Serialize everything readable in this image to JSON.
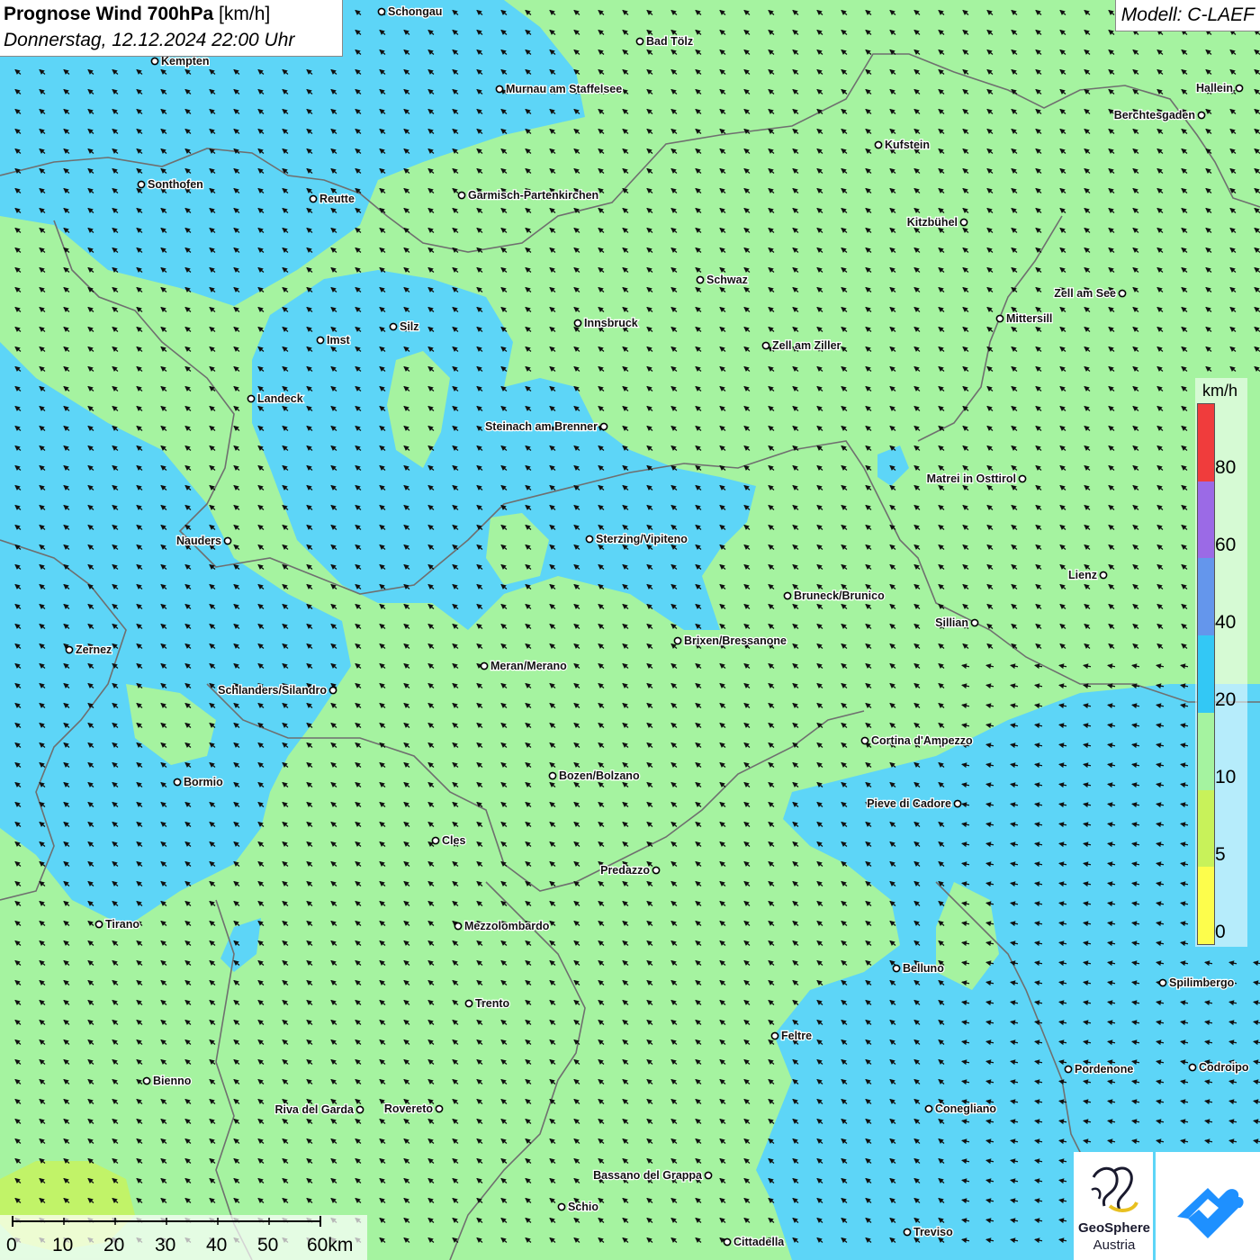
{
  "title": {
    "main": "Prognose Wind 700hPa",
    "unit": "[km/h]",
    "datetime": "Donnerstag, 12.12.2024 22:00 Uhr"
  },
  "model_label": "Modell: C-LAEF",
  "legend": {
    "unit": "km/h",
    "labels": [
      "80",
      "60",
      "40",
      "20",
      "10",
      "5",
      "0"
    ],
    "bins": [
      {
        "from": 0,
        "to": 5,
        "color": "#fdfd4c"
      },
      {
        "from": 5,
        "to": 10,
        "color": "#c8f25a"
      },
      {
        "from": 10,
        "to": 20,
        "color": "#a5f3a0"
      },
      {
        "from": 20,
        "to": 40,
        "color": "#33c8f5"
      },
      {
        "from": 40,
        "to": 60,
        "color": "#6496ec"
      },
      {
        "from": 60,
        "to": 80,
        "color": "#9b6ae6"
      },
      {
        "from": 80,
        "to": 100,
        "color": "#f03c3c"
      }
    ]
  },
  "scale_bar": {
    "labels": [
      "0",
      "10",
      "20",
      "30",
      "40",
      "50",
      "60km"
    ]
  },
  "logos": {
    "geosphere_line1": "GeoSphere",
    "geosphere_line2": "Austria"
  },
  "colors": {
    "green_10_20": "#a5f3a0",
    "blue_20_40": "#5dd5f7",
    "arrow": "#111111",
    "border": "#6f6f6f"
  },
  "towns": [
    {
      "name": "Schongau"
    },
    {
      "name": "Bad Tölz"
    },
    {
      "name": "Kempten"
    },
    {
      "name": "Murnau am Staffelsee"
    },
    {
      "name": "Hallein"
    },
    {
      "name": "Berchtesgaden"
    },
    {
      "name": "Kufstein"
    },
    {
      "name": "Sonthofen"
    },
    {
      "name": "Reutte"
    },
    {
      "name": "Garmisch-Partenkirchen"
    },
    {
      "name": "Kitzbühel"
    },
    {
      "name": "Schwaz"
    },
    {
      "name": "Zell am See"
    },
    {
      "name": "Mittersill"
    },
    {
      "name": "Silz"
    },
    {
      "name": "Innsbruck"
    },
    {
      "name": "Imst"
    },
    {
      "name": "Zell am Ziller"
    },
    {
      "name": "Landeck"
    },
    {
      "name": "Steinach am Brenner"
    },
    {
      "name": "Matrei in Osttirol"
    },
    {
      "name": "Nauders"
    },
    {
      "name": "Sterzing/Vipiteno"
    },
    {
      "name": "Lienz"
    },
    {
      "name": "Bruneck/Brunico"
    },
    {
      "name": "Sillian"
    },
    {
      "name": "Zernez"
    },
    {
      "name": "Brixen/Bressanone"
    },
    {
      "name": "Meran/Merano"
    },
    {
      "name": "Schlanders/Silandro"
    },
    {
      "name": "Cortina d'Ampezzo"
    },
    {
      "name": "Bozen/Bolzano"
    },
    {
      "name": "Bormio"
    },
    {
      "name": "Pieve di Cadore"
    },
    {
      "name": "Cles"
    },
    {
      "name": "Predazzo"
    },
    {
      "name": "Tirano"
    },
    {
      "name": "Mezzolombardo"
    },
    {
      "name": "Belluno"
    },
    {
      "name": "Spilimbergo"
    },
    {
      "name": "Trento"
    },
    {
      "name": "Feltre"
    },
    {
      "name": "Pordenone"
    },
    {
      "name": "Codroipo"
    },
    {
      "name": "Bienno"
    },
    {
      "name": "Riva del Garda"
    },
    {
      "name": "Rovereto"
    },
    {
      "name": "Conegliano"
    },
    {
      "name": "Bassano del Grappa"
    },
    {
      "name": "Schio"
    },
    {
      "name": "Treviso"
    },
    {
      "name": "Cittadella"
    }
  ]
}
